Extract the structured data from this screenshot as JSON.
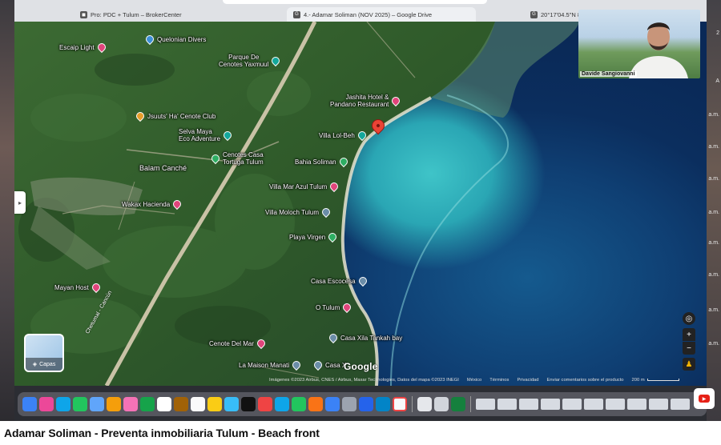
{
  "browser": {
    "tabs": [
      {
        "label": "Pro: PDC + Tulum – BrokerCenter",
        "icon": "brokercenter-icon"
      },
      {
        "label": "4.- Adamar Soliman (NOV 2025) – Google Drive",
        "icon": "drive-icon"
      },
      {
        "label": "20°17'04.5\"N 8",
        "icon": "maps-icon"
      }
    ]
  },
  "desktop": {
    "right_edge_text": [
      "2",
      "A",
      "a.m.",
      "a.m.",
      "a.m.",
      "a.m.",
      "a.m.",
      "a.m.",
      "a.m.",
      "a.m."
    ]
  },
  "map": {
    "places": [
      {
        "name": "Quelonian Divers",
        "icon": "dive-icon",
        "color": "blue"
      },
      {
        "name": "Escaip Light",
        "icon": "hotel-icon",
        "color": "pink"
      },
      {
        "name": "Parque De\nCenotes Yaxmuul",
        "icon": "park-icon",
        "color": "teal"
      },
      {
        "name": "Jashita Hotel &\nPandano Restaurant",
        "icon": "hotel-icon",
        "color": "pink"
      },
      {
        "name": "Jsuuts' Ha' Cenote Club",
        "icon": "cenote-icon",
        "color": "orange"
      },
      {
        "name": "Selva Maya\nEco Adventure",
        "icon": "park-icon",
        "color": "teal"
      },
      {
        "name": "Villa Lol-Beh",
        "icon": "villa-icon",
        "color": "teal"
      },
      {
        "name": "Cenotes Casa\nTortuga Tulum",
        "icon": "park-icon",
        "color": "green"
      },
      {
        "name": "Balam Canché",
        "icon": "place-icon",
        "color": "none"
      },
      {
        "name": "Bahia Soliman",
        "icon": "beach-icon",
        "color": "green"
      },
      {
        "name": "Villa Mar Azul Tulum",
        "icon": "hotel-icon",
        "color": "pink"
      },
      {
        "name": "Wakax Hacienda",
        "icon": "hotel-icon",
        "color": "pink"
      },
      {
        "name": "Villa Moloch Tulum",
        "icon": "villa-icon",
        "color": "gray"
      },
      {
        "name": "Playa Virgen",
        "icon": "beach-icon",
        "color": "green"
      },
      {
        "name": "Mayan Host",
        "icon": "hotel-icon",
        "color": "pink"
      },
      {
        "name": "Casa Escocesa",
        "icon": "villa-icon",
        "color": "gray"
      },
      {
        "name": "O Tulum",
        "icon": "hotel-icon",
        "color": "pink"
      },
      {
        "name": "Casa Xila Tankah bay",
        "icon": "villa-icon",
        "color": "gray"
      },
      {
        "name": "Cenote Del Mar",
        "icon": "hotel-icon",
        "color": "pink"
      },
      {
        "name": "La Maison Manati",
        "icon": "villa-icon",
        "color": "gray"
      },
      {
        "name": "Casa X",
        "icon": "villa-icon",
        "color": "gray"
      }
    ],
    "road_label": "Chetumal - Cancún",
    "layers_label": "Capas",
    "google_logo": "Google",
    "attribution": "Imágenes ©2023 Airbus, CNES / Airbus, Maxar Technologies, Datos del mapa ©2023 INEGI",
    "footer_links": [
      "México",
      "Términos",
      "Privacidad",
      "Enviar comentarios sobre el producto"
    ],
    "scale": "200 m",
    "colors": {
      "land": "#2f5a2a",
      "lagoon": "#3fc4c8",
      "ocean": "#0b2b58",
      "pin_red": "#ea4335"
    }
  },
  "webcam": {
    "name": "Davide Sangiovanni"
  },
  "video_title": "Adamar Soliman - Preventa inmobiliaria Tulum - Beach front"
}
